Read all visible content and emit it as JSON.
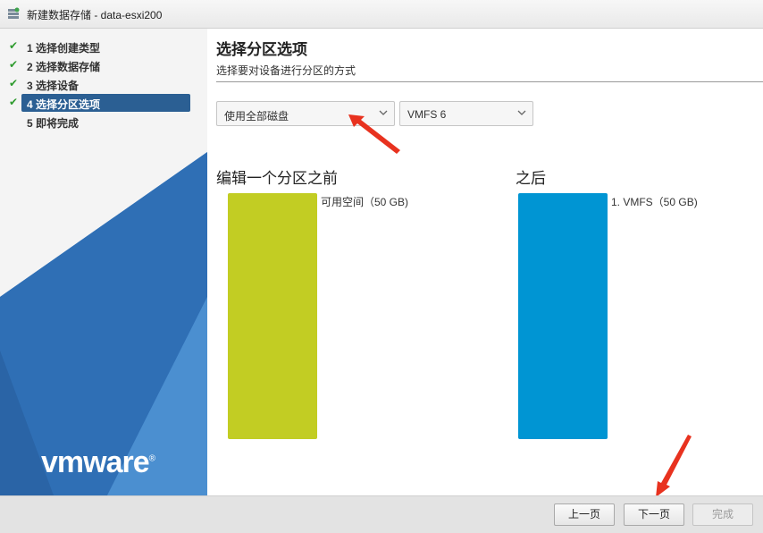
{
  "window": {
    "title": "新建数据存储 - data-esxi200"
  },
  "sidebar": {
    "steps": [
      {
        "label": "1 选择创建类型",
        "done": true,
        "active": false
      },
      {
        "label": "2 选择数据存储",
        "done": true,
        "active": false
      },
      {
        "label": "3 选择设备",
        "done": true,
        "active": false
      },
      {
        "label": "4 选择分区选项",
        "done": true,
        "active": true
      },
      {
        "label": "5 即将完成",
        "done": false,
        "active": false
      }
    ],
    "check_glyph": "✔",
    "logo_text": "vmware",
    "logo_mark": "®"
  },
  "main": {
    "title": "选择分区选项",
    "subtitle": "选择要对设备进行分区的方式",
    "partition_select": {
      "value": "使用全部磁盘"
    },
    "fs_select": {
      "value": "VMFS 6"
    },
    "before": {
      "heading": "编辑一个分区之前",
      "label": "可用空间（50 GB)",
      "color": "#c2cd23"
    },
    "after": {
      "heading": "之后",
      "label": "1. VMFS（50 GB)",
      "color": "#0095d3"
    }
  },
  "footer": {
    "back_label": "上一页",
    "next_label": "下一页",
    "finish_label": "完成"
  },
  "colors": {
    "accent": "#2b5f93",
    "annotation_arrow": "#e8321f"
  }
}
